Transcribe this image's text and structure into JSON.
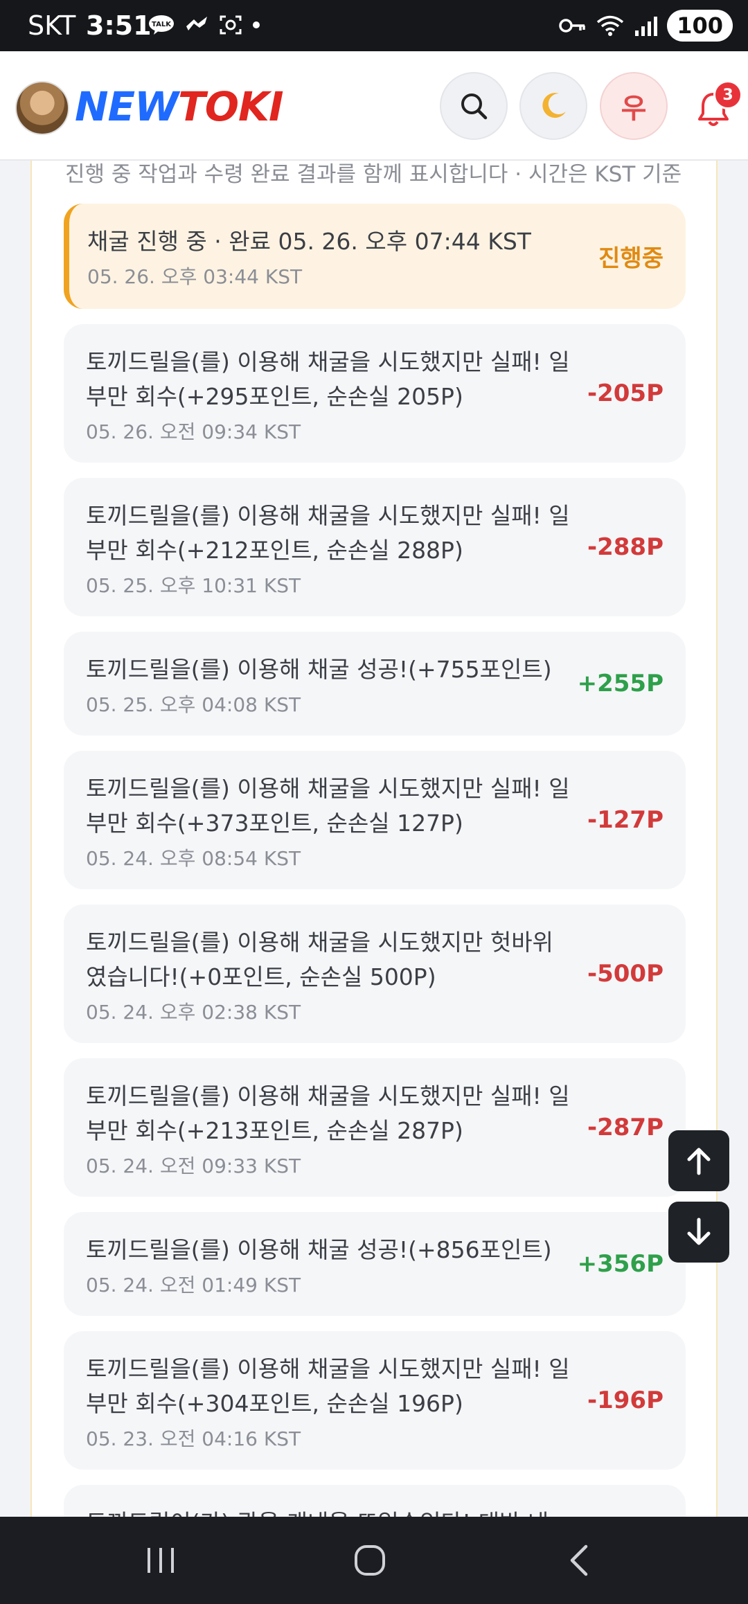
{
  "statusbar": {
    "carrier": "SKT",
    "time": "3:51",
    "battery": "100"
  },
  "header": {
    "logo_new": "NEW",
    "logo_toki": "TOKI",
    "user_initial": "우",
    "notification_count": "3"
  },
  "subtitle": "진행 중 작업과 수령 완료 결과를 함께 표시합니다 · 시간은 KST 기준",
  "items": [
    {
      "message": "채굴 진행 중 · 완료 05. 26. 오후 07:44 KST",
      "time": "05. 26. 오후 03:44 KST",
      "amount": "진행중"
    },
    {
      "message": "토끼드릴을(를) 이용해 채굴을 시도했지만 실패! 일부만 회수(+295포인트, 순손실 205P)",
      "time": "05. 26. 오전 09:34 KST",
      "amount": "-205P"
    },
    {
      "message": "토끼드릴을(를) 이용해 채굴을 시도했지만 실패! 일부만 회수(+212포인트, 순손실 288P)",
      "time": "05. 25. 오후 10:31 KST",
      "amount": "-288P"
    },
    {
      "message": "토끼드릴을(를) 이용해 채굴 성공!(+755포인트)",
      "time": "05. 25. 오후 04:08 KST",
      "amount": "+255P"
    },
    {
      "message": "토끼드릴을(를) 이용해 채굴을 시도했지만 실패! 일부만 회수(+373포인트, 순손실 127P)",
      "time": "05. 24. 오후 08:54 KST",
      "amount": "-127P"
    },
    {
      "message": "토끼드릴을(를) 이용해 채굴을 시도했지만 헛바위였습니다!(+0포인트, 순손실 500P)",
      "time": "05. 24. 오후 02:38 KST",
      "amount": "-500P"
    },
    {
      "message": "토끼드릴을(를) 이용해 채굴을 시도했지만 실패! 일부만 회수(+213포인트, 순손실 287P)",
      "time": "05. 24. 오전 09:33 KST",
      "amount": "-287P"
    },
    {
      "message": "토끼드릴을(를) 이용해 채굴 성공!(+856포인트)",
      "time": "05. 24. 오전 01:49 KST",
      "amount": "+356P"
    },
    {
      "message": "토끼드릴을(를) 이용해 채굴을 시도했지만 실패! 일부만 회수(+304포인트, 순손실 196P)",
      "time": "05. 23. 오전 04:16 KST",
      "amount": "-196P"
    },
    {
      "message": "토끼드릴이(가) 광을 캐내을 뜨일수있다! 대박 내",
      "time": "",
      "amount": ""
    }
  ],
  "colors": {
    "negative": "#d23a3a",
    "positive": "#2ea04a",
    "in_progress": "#e08a12",
    "accent_border": "#f0a320"
  },
  "icons": {
    "search": "search-icon",
    "moon": "moon-icon",
    "bell": "bell-icon",
    "scroll_up": "arrow-up-icon",
    "scroll_down": "arrow-down-icon"
  }
}
